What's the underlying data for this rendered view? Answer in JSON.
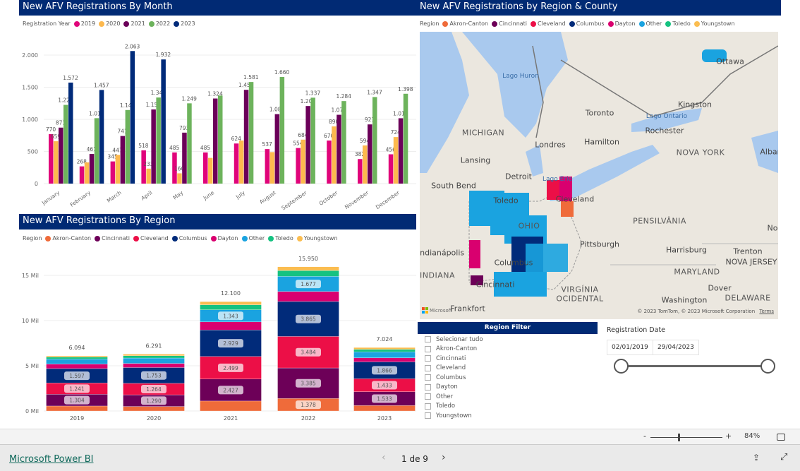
{
  "colors": {
    "header": "#012a74",
    "y2019": "#e0047a",
    "y2020": "#fdb94e",
    "y2021": "#6b0059",
    "y2022": "#6db35c",
    "y2023": "#012b7a"
  },
  "month_chart": {
    "title": "New AFV Registrations By Month",
    "legend_title": "Registration Year",
    "chart_data": {
      "type": "bar",
      "title": "New AFV Registrations By Month",
      "categories": [
        "January",
        "February",
        "March",
        "April",
        "May",
        "June",
        "July",
        "August",
        "September",
        "October",
        "November",
        "December"
      ],
      "series": [
        {
          "name": "2019",
          "color": "#e0047a",
          "values": [
            770,
            268,
            345,
            518,
            485,
            485,
            624,
            537,
            554,
            670,
            382,
            456
          ]
        },
        {
          "name": "2020",
          "color": "#fdb94e",
          "values": [
            659,
            330,
            447,
            233,
            160,
            400,
            670,
            490,
            684,
            890,
            594,
            724
          ]
        },
        {
          "name": "2021",
          "color": "#6b0059",
          "values": [
            871,
            461,
            741,
            1154,
            793,
            1324,
            1459,
            1081,
            1207,
            1071,
            921,
            1017
          ]
        },
        {
          "name": "2022",
          "color": "#6db35c",
          "values": [
            1225,
            1018,
            1145,
            1340,
            1249,
            1370,
            1581,
            1660,
            1337,
            1284,
            1347,
            1398
          ]
        },
        {
          "name": "2023",
          "color": "#012b7a",
          "values": [
            1572,
            1457,
            2063,
            1932,
            null,
            null,
            null,
            null,
            null,
            null,
            null,
            null
          ]
        }
      ],
      "labels": [
        [
          "770",
          "659",
          "871",
          "1.225",
          "1.572"
        ],
        [
          "268",
          "",
          "461",
          "1.018",
          "1.457"
        ],
        [
          "345",
          "447",
          "741",
          "1.145",
          "2.063"
        ],
        [
          "518",
          "233",
          "1.154",
          "1.340",
          "1.932"
        ],
        [
          "485",
          "160",
          "793",
          "1.249",
          ""
        ],
        [
          "485",
          "",
          "1.324",
          "",
          ""
        ],
        [
          "624",
          "",
          "1.459",
          "1.581",
          ""
        ],
        [
          "537",
          "",
          "1.081",
          "1.660",
          ""
        ],
        [
          "554",
          "684",
          "1.207",
          "1.337",
          ""
        ],
        [
          "670",
          "890",
          "1.071",
          "1.284",
          ""
        ],
        [
          "382",
          "594",
          "921",
          "1.347",
          ""
        ],
        [
          "456",
          "724",
          "1.017",
          "1.398",
          ""
        ]
      ],
      "yticks": [
        "0",
        "500",
        "1.000",
        "1.500",
        "2.000"
      ],
      "ylim": [
        0,
        2100
      ],
      "grid": true,
      "legend": "top-left"
    }
  },
  "region_chart": {
    "title": "New AFV Registrations By Region",
    "legend_title": "Region",
    "chart_data": {
      "type": "bar",
      "stacked": true,
      "title": "New AFV Registrations By Region",
      "categories": [
        "2019",
        "2020",
        "2021",
        "2022",
        "2023"
      ],
      "totals": [
        "6.094",
        "6.291",
        "12.100",
        "15.950",
        "7.024"
      ],
      "series": [
        {
          "name": "Akron-Canton",
          "color": "#ef6b3a",
          "values": [
            550,
            500,
            1100,
            1378,
            600
          ],
          "labels": [
            "",
            "",
            "",
            "1.378",
            ""
          ]
        },
        {
          "name": "Cincinnati",
          "color": "#6d0058",
          "values": [
            1304,
            1290,
            2427,
            3385,
            1533
          ],
          "labels": [
            "1.304",
            "1.290",
            "2.427",
            "3.385",
            "1.533"
          ]
        },
        {
          "name": "Cleveland",
          "color": "#ec0f47",
          "values": [
            1241,
            1264,
            2499,
            3484,
            1433
          ],
          "labels": [
            "1.241",
            "1.264",
            "2.499",
            "3.484",
            "1.433"
          ]
        },
        {
          "name": "Columbus",
          "color": "#012b7a",
          "values": [
            1597,
            1753,
            2929,
            3865,
            1866
          ],
          "labels": [
            "1.597",
            "1.753",
            "2.929",
            "3.865",
            "1.866"
          ]
        },
        {
          "name": "Dayton",
          "color": "#d9006f",
          "values": [
            500,
            450,
            900,
            1100,
            450
          ],
          "labels": [
            "",
            "",
            "",
            "",
            ""
          ]
        },
        {
          "name": "Other",
          "color": "#1aa3e0",
          "values": [
            550,
            600,
            1343,
            1677,
            650
          ],
          "labels": [
            "",
            "",
            "1.343",
            "1.677",
            ""
          ]
        },
        {
          "name": "Toledo",
          "color": "#15c281",
          "values": [
            230,
            250,
            550,
            650,
            280
          ],
          "labels": [
            "",
            "",
            "",
            "",
            ""
          ]
        },
        {
          "name": "Youngstown",
          "color": "#fbbd50",
          "values": [
            122,
            184,
            352,
            411,
            212
          ],
          "labels": [
            "",
            "",
            "",
            "",
            ""
          ]
        }
      ],
      "yticks": [
        "0 Mil",
        "5 Mil",
        "10 Mil",
        "15 Mil"
      ],
      "ylim": [
        0,
        16500
      ],
      "grid": true,
      "legend": "top-left"
    }
  },
  "map": {
    "title": "New AFV Registrations by Region & County",
    "legend_title": "Region",
    "labels": [
      "Ottawa",
      "Lago Huron",
      "MICHIGAN",
      "Toronto",
      "Kingston",
      "Lago Ontario",
      "Rochester",
      "Hamilton",
      "Londres",
      "NOVA YORK",
      "Alban",
      "Lansing",
      "Detroit",
      "Lago Erie",
      "South Bend",
      "Toledo",
      "Cleveland",
      "PENSILVÂNIA",
      "OHIO",
      "Pittsburgh",
      "Harrisburg",
      "Trenton",
      "NOVA JERSEY",
      "Indianápolis",
      "INDIANA",
      "Columbus",
      "MARYLAND",
      "Cincinnati",
      "Dover",
      "VIRGÍNIA",
      "OCIDENTAL",
      "DELAWARE",
      "Washington",
      "Frankfort",
      "No"
    ],
    "copyright": "© 2023 TomTom, © 2023 Microsoft Corporation",
    "terms": "Terms",
    "ms_logo": "Microsoft"
  },
  "region_filter": {
    "title": "Region Filter",
    "items": [
      "Selecionar tudo",
      "Akron-Canton",
      "Cincinnati",
      "Cleveland",
      "Columbus",
      "Dayton",
      "Other",
      "Toledo",
      "Youngstown"
    ]
  },
  "date_filter": {
    "title": "Registration Date",
    "start": "02/01/2019",
    "end": "29/04/2023",
    "range_fraction": [
      0,
      1
    ]
  },
  "zoom_bar": {
    "minus": "-",
    "plus": "+",
    "zoom": "84%",
    "zoom_level": 0.5
  },
  "footer": {
    "brand": "Microsoft Power BI",
    "page": "1 de 9"
  }
}
